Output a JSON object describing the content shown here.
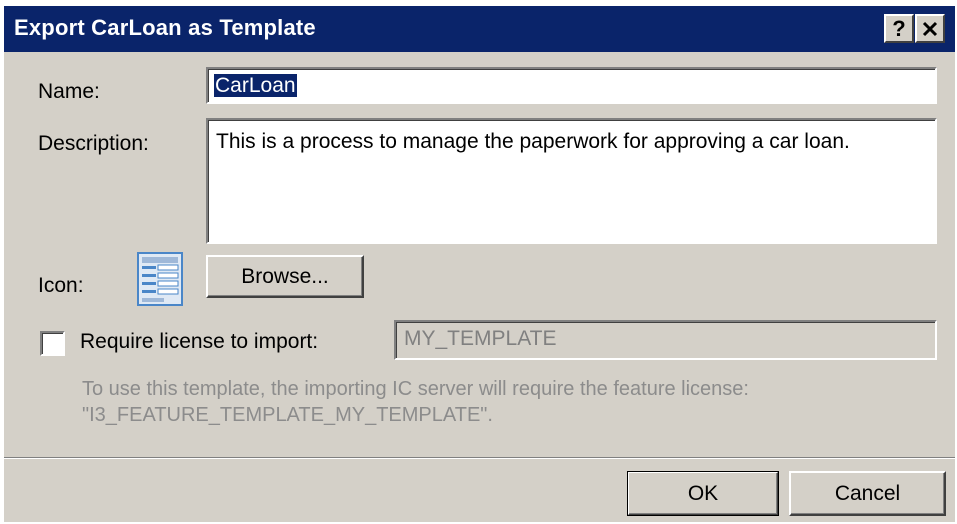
{
  "window": {
    "title": "Export CarLoan as Template",
    "help_label": "?",
    "close_label": "✕"
  },
  "form": {
    "name_label": "Name:",
    "name_value": "CarLoan",
    "description_label": "Description:",
    "description_value": "This is a process to manage the paperwork for approving a car loan.",
    "icon_label": "Icon:",
    "icon": "template-document-icon",
    "browse_label": "Browse...",
    "require_license_label": "Require license to import:",
    "require_license_checked": false,
    "license_value": "MY_TEMPLATE",
    "note_line1": "To use this template, the importing IC server will require the feature license:",
    "note_line2": "\"I3_FEATURE_TEMPLATE_MY_TEMPLATE\"."
  },
  "buttons": {
    "ok_label": "OK",
    "cancel_label": "Cancel"
  },
  "colors": {
    "title_bar": "#0a246a",
    "dialog_bg": "#d4d0c8",
    "disabled_text": "#8c8c8c",
    "icon_blue": "#4a86c8"
  }
}
